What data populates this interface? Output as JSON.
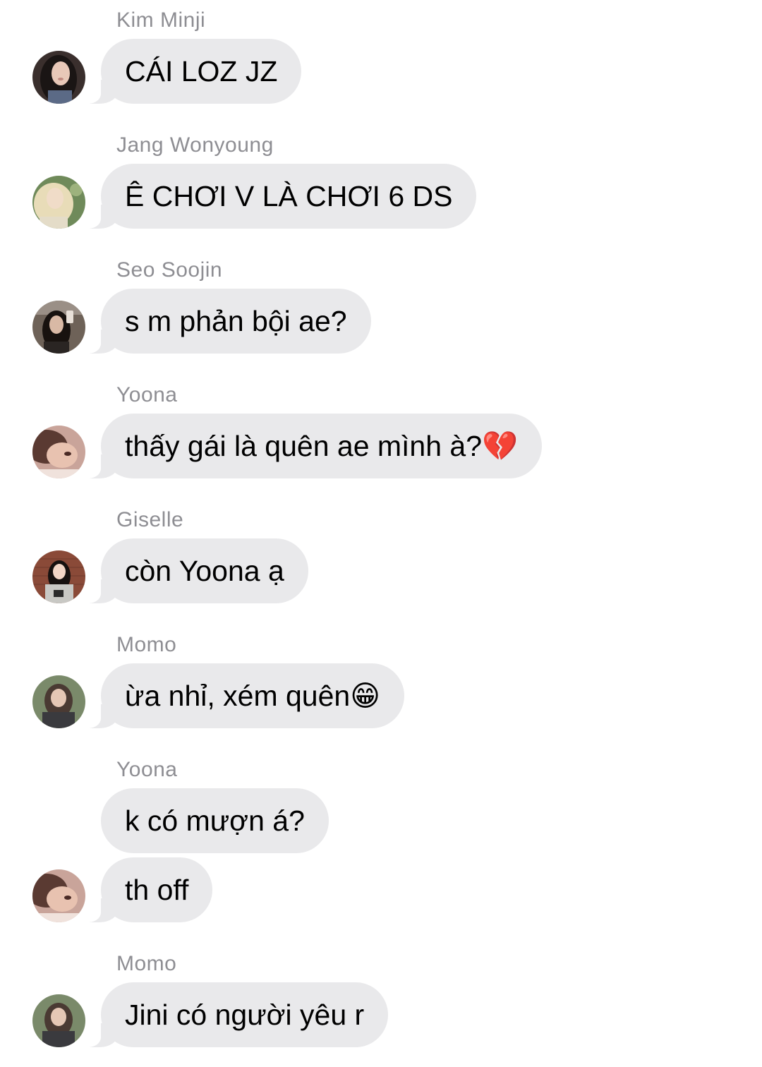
{
  "messages": [
    {
      "sender": "Kim Minji",
      "text": "CÁI LOZ JZ"
    },
    {
      "sender": "Jang Wonyoung",
      "text": "Ê CHƠI V LÀ CHƠI 6 DS"
    },
    {
      "sender": "Seo Soojin",
      "text": "s m phản bội ae?"
    },
    {
      "sender": "Yoona",
      "text": "thấy gái là quên ae mình à?💔"
    },
    {
      "sender": "Giselle",
      "text": "còn Yoona ạ"
    },
    {
      "sender": "Momo",
      "text": "ừa nhỉ, xém quên😁"
    },
    {
      "sender": "Yoona",
      "text": "k có mượn á?"
    },
    {
      "sender": "",
      "text": "th off"
    },
    {
      "sender": "Momo",
      "text": "Jini có người yêu r"
    }
  ],
  "avatars": {
    "kim_minji": {
      "icon": "avatar-photo",
      "skin": "#e8c8b8",
      "hair": "#1a1514",
      "bg": "#3a2f2d"
    },
    "jang_wonyoung": {
      "icon": "avatar-photo",
      "skin": "#f0dcc8",
      "hair": "#e8dcb8",
      "bg": "#6f8a5a"
    },
    "seo_soojin": {
      "icon": "avatar-photo",
      "skin": "#d9b9a5",
      "hair": "#18120f",
      "bg": "#6e6258"
    },
    "yoona": {
      "icon": "avatar-photo",
      "skin": "#e8c2b0",
      "hair": "#5a3a32",
      "bg": "#c9a49a"
    },
    "giselle": {
      "icon": "avatar-photo",
      "skin": "#f2d6c6",
      "hair": "#16110f",
      "bg": "#8a4a38"
    },
    "momo": {
      "icon": "avatar-photo",
      "skin": "#e5c7b5",
      "hair": "#4a3a33",
      "bg": "#7a8a6a"
    }
  }
}
